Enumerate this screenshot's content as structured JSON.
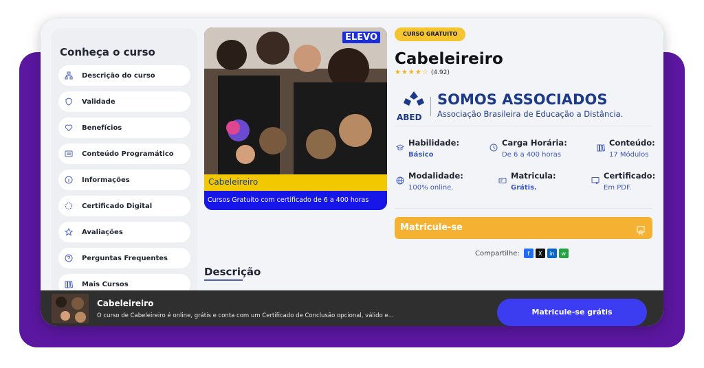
{
  "sidebar": {
    "title": "Conheça o curso",
    "items": [
      {
        "label": "Descrição do curso",
        "icon": "hierarchy-icon"
      },
      {
        "label": "Validade",
        "icon": "shield-icon"
      },
      {
        "label": "Benefícios",
        "icon": "heart-icon"
      },
      {
        "label": "Conteúdo Programático",
        "icon": "list-icon"
      },
      {
        "label": "Informações",
        "icon": "info-icon"
      },
      {
        "label": "Certificado Digital",
        "icon": "certificate-icon"
      },
      {
        "label": "Avaliações",
        "icon": "star-icon"
      },
      {
        "label": "Perguntas Frequentes",
        "icon": "question-icon"
      },
      {
        "label": "Mais Cursos",
        "icon": "books-icon"
      }
    ]
  },
  "hero": {
    "logo": "ELEVO",
    "caption_title": "Cabeleireiro",
    "caption_sub": "Cursos Gratuito com certificado de 6 a 400 horas"
  },
  "course": {
    "badge": "CURSO GRATUITO",
    "title": "Cabeleireiro",
    "stars": "★★★★☆",
    "rating": "(4.92)"
  },
  "abed": {
    "label": "ABED",
    "headline": "SOMOS ASSOCIADOS",
    "subline": "Associação Brasileira de Educação a Distância."
  },
  "info": {
    "habilidade": {
      "title": "Habilidade:",
      "value": "Básico"
    },
    "carga": {
      "title": "Carga Horária:",
      "value": "De 6 a 400 horas"
    },
    "conteudo": {
      "title": "Conteúdo:",
      "value": "17 Módulos"
    },
    "modalidade": {
      "title": "Modalidade:",
      "value": "100% online."
    },
    "matricula": {
      "title": "Matricula:",
      "value": "Grátis."
    },
    "certificado": {
      "title": "Certificado:",
      "value": "Em PDF."
    }
  },
  "cta": {
    "label": "Matricule-se"
  },
  "share": {
    "label": "Compartilhe:",
    "buttons": [
      "facebook",
      "x",
      "linkedin",
      "whatsapp"
    ]
  },
  "description": {
    "heading": "Descrição"
  },
  "footer": {
    "title": "Cabeleireiro",
    "desc": "O curso de Cabeleireiro é online, grátis e conta com um Certificado de Conclusão opcional, válido e...",
    "button": "Matricule-se grátis"
  },
  "colors": {
    "purple": "#5b17a0",
    "accent_blue": "#3c58c7",
    "cta_orange": "#f5b132",
    "badge_yellow": "#f5c431",
    "footer_btn": "#3c3cf0"
  }
}
